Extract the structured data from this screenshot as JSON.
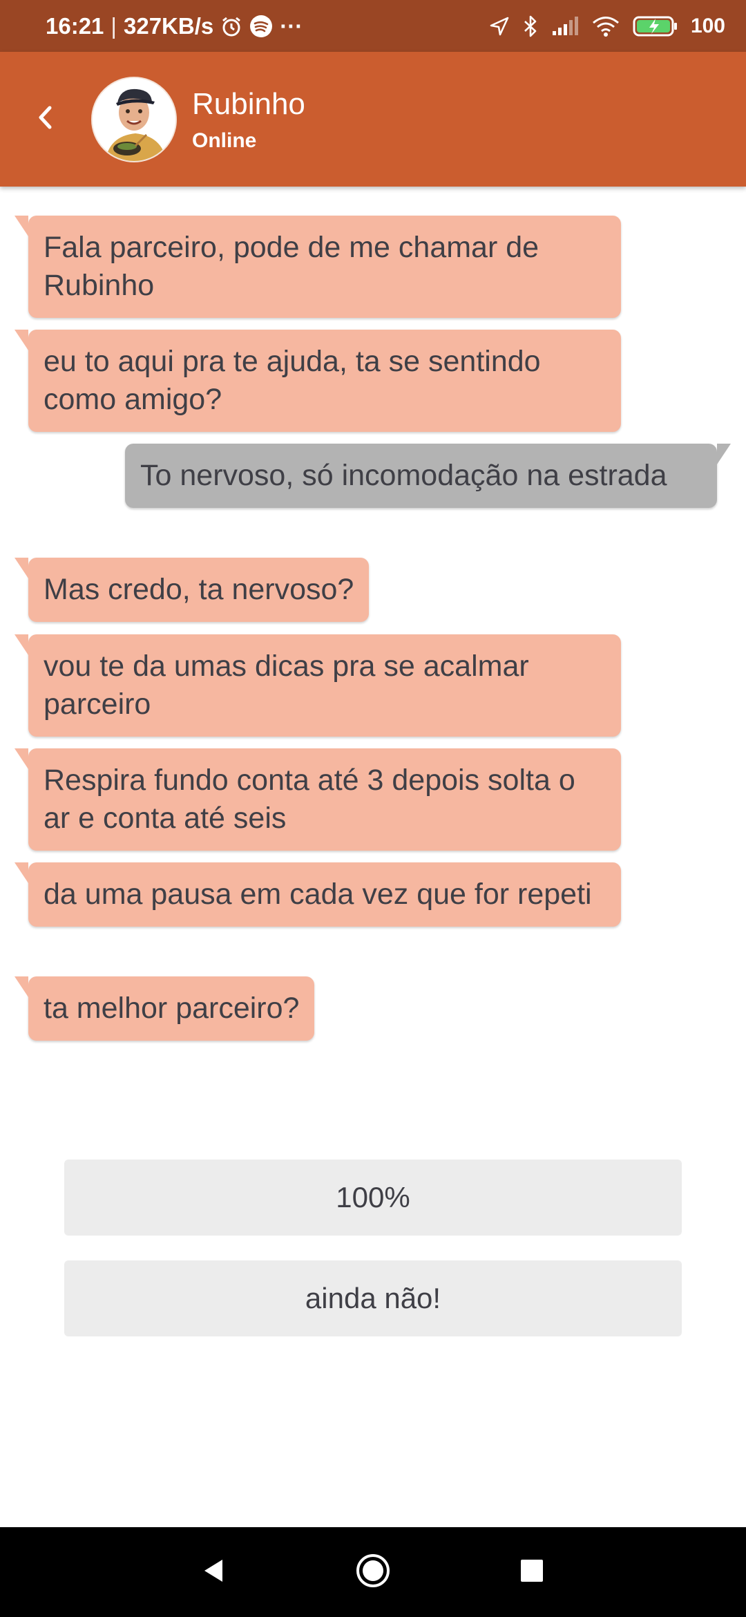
{
  "status_bar": {
    "time": "16:21",
    "separator": "|",
    "speed": "327KB/s",
    "more": "···",
    "battery": "100",
    "icons": [
      "alarm-icon",
      "spotify-icon",
      "location-icon",
      "bluetooth-icon",
      "signal-icon",
      "wifi-icon",
      "battery-charging-icon"
    ]
  },
  "header": {
    "contact_name": "Rubinho",
    "status": "Online",
    "back_icon": "chevron-left-icon"
  },
  "messages": [
    {
      "from": "bot",
      "text": "Fala parceiro, pode de me chamar de Rubinho"
    },
    {
      "from": "bot",
      "text": "eu to aqui pra te ajuda, ta se sentindo como amigo?"
    },
    {
      "from": "user",
      "text": "To nervoso, só incomodação na estrada"
    },
    {
      "from": "bot",
      "text": "Mas credo, ta nervoso?"
    },
    {
      "from": "bot",
      "text": "vou te da umas dicas pra se acalmar parceiro"
    },
    {
      "from": "bot",
      "text": "Respira fundo conta até 3 depois solta o ar e conta até seis"
    },
    {
      "from": "bot",
      "text": "da uma pausa em cada vez que for repeti"
    },
    {
      "from": "bot",
      "text": "ta melhor parceiro?"
    }
  ],
  "quick_replies": [
    "100%",
    "ainda não!"
  ],
  "nav": {
    "back": "back-triangle-icon",
    "home": "home-circle-icon",
    "recents": "recents-square-icon"
  },
  "colors": {
    "status_bar": "#9a4624",
    "app_bar": "#cb5d2f",
    "bot_bubble": "#f6b7a0",
    "user_bubble": "#b3b3b3",
    "reply_button": "#ececec"
  }
}
